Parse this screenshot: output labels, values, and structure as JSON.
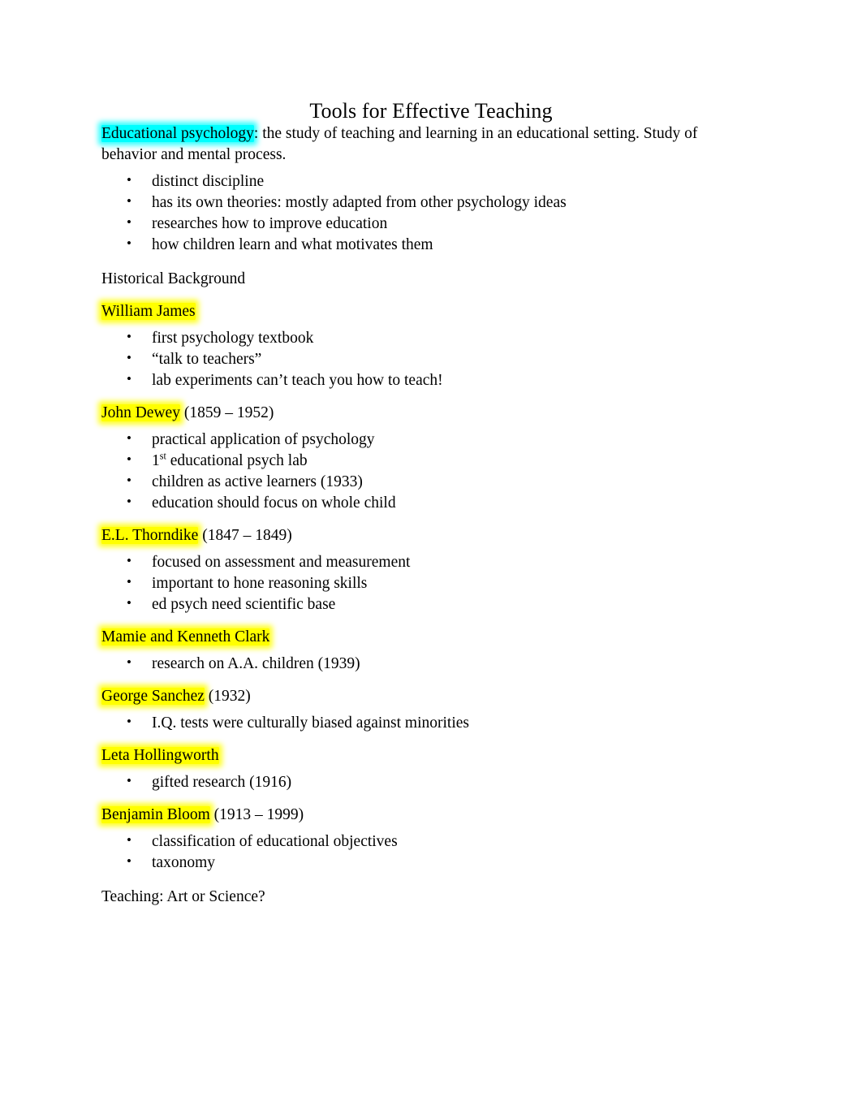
{
  "document": {
    "title": "Tools for Effective Teaching",
    "intro": {
      "highlight_term": "Educational psychology",
      "highlight_color": "#00ffff",
      "rest": ": the study of teaching and learning in an educational setting. Study of behavior and mental process."
    },
    "intro_bullets": [
      "distinct discipline",
      "has its own theories: mostly adapted from other psychology ideas",
      "researches how to improve education",
      "how children learn and what motivates them"
    ],
    "historical_heading": "Historical Background",
    "highlight_color_name": "#ffff00",
    "sections": [
      {
        "name": "William James",
        "dates": "",
        "bullets": [
          "first psychology textbook",
          "“talk to teachers”",
          "lab experiments can’t teach you how to teach!"
        ]
      },
      {
        "name": "John Dewey",
        "dates": " (1859 – 1952)",
        "bullets": [
          "practical application of psychology",
          "1st educational psych lab",
          "children as active learners (1933)",
          "education should focus on whole child"
        ],
        "bullet_superscript_index": 1,
        "bullet_superscript": {
          "base": "1",
          "sup": "st",
          "tail": " educational psych lab"
        }
      },
      {
        "name": "E.L. Thorndike",
        "dates": " (1847 – 1849)",
        "bullets": [
          "focused on assessment and measurement",
          "important to hone reasoning skills",
          "ed psych need scientific base"
        ]
      },
      {
        "name": "Mamie and Kenneth Clark",
        "dates": "",
        "bullets": [
          "research on A.A. children (1939)"
        ]
      },
      {
        "name": "George Sanchez",
        "dates": " (1932)",
        "bullets": [
          "I.Q. tests were culturally biased against minorities"
        ]
      },
      {
        "name": "Leta Hollingworth",
        "dates": "",
        "bullets": [
          "gifted research (1916)"
        ]
      },
      {
        "name": "Benjamin Bloom",
        "dates": " (1913 – 1999)",
        "bullets": [
          "classification of educational objectives",
          "taxonomy"
        ]
      }
    ],
    "closing_heading": "Teaching: Art or Science?"
  }
}
